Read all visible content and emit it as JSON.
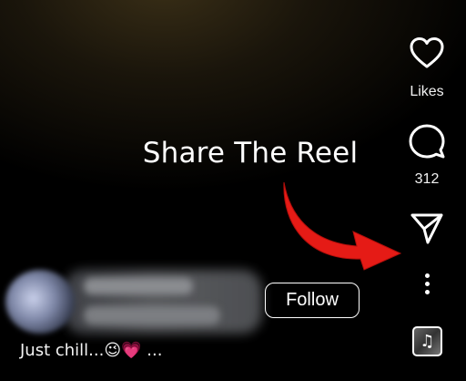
{
  "annotation": {
    "text": "Share The Reel",
    "color": "#ffffff",
    "arrow_color": "#e51b16"
  },
  "rail": {
    "like": {
      "icon": "heart-icon",
      "label": "Likes"
    },
    "comment": {
      "icon": "comment-icon",
      "count": "312"
    },
    "share": {
      "icon": "send-icon"
    },
    "more": {
      "icon": "more-vertical-icon"
    },
    "music": {
      "icon": "music-note-icon",
      "glyph": "♫"
    }
  },
  "post": {
    "follow_label": "Follow",
    "caption": "Just chill...😉💗 ..."
  }
}
